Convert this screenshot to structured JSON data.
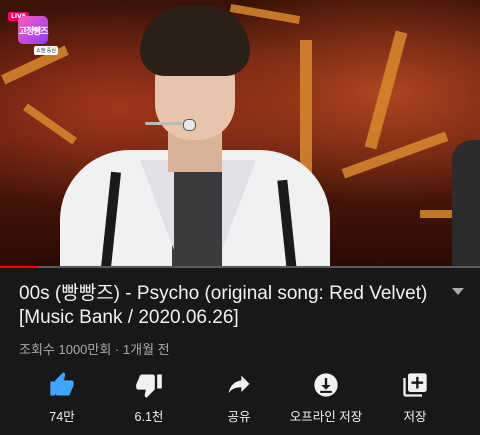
{
  "video": {
    "overlay_logo": {
      "live_tag": "LIVE",
      "mark": "고정빵즈",
      "sub": "쇼챔 중심"
    },
    "progress": 0.08,
    "colors": {
      "progress": "#ff0000",
      "accent_like": "#3ea6ff"
    }
  },
  "details": {
    "title": "00s (빵빵즈) - Psycho (original song: Red Velvet) [Music Bank / 2020.06.26]",
    "meta": "조회수 1000만회 · 1개월 전"
  },
  "actions": [
    {
      "icon": "thumbs-up-icon",
      "label": "74만"
    },
    {
      "icon": "thumbs-down-icon",
      "label": "6.1천"
    },
    {
      "icon": "share-icon",
      "label": "공유"
    },
    {
      "icon": "download-icon",
      "label": "오프라인 저장"
    },
    {
      "icon": "playlist-add-icon",
      "label": "저장"
    }
  ]
}
